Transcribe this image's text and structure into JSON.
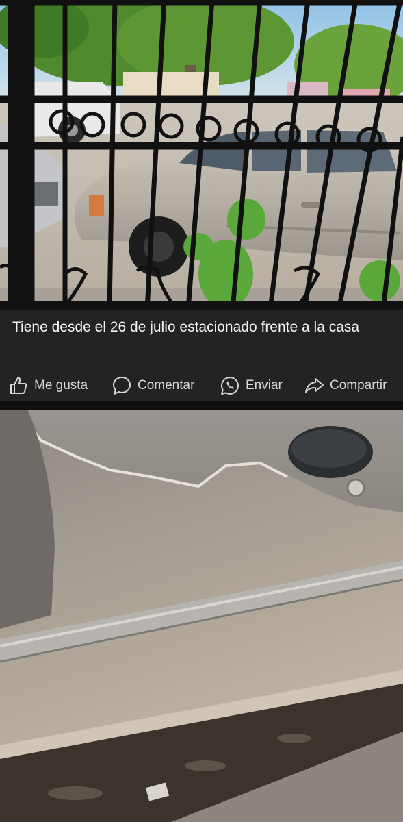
{
  "post": {
    "caption": "Tiene desde el 26 de julio estacionado frente a la casa"
  },
  "actions": {
    "like_label": "Me gusta",
    "comment_label": "Comentar",
    "send_label": "Enviar",
    "share_label": "Compartir",
    "like_icon": "thumbs-up-icon",
    "comment_icon": "speech-bubble-icon",
    "send_icon": "whatsapp-icon",
    "share_icon": "share-arrow-icon"
  },
  "colors": {
    "background": "#1f1f20",
    "caption_bg": "#232324",
    "text": "#f4f4f4",
    "action_text": "#d8d8d8"
  }
}
